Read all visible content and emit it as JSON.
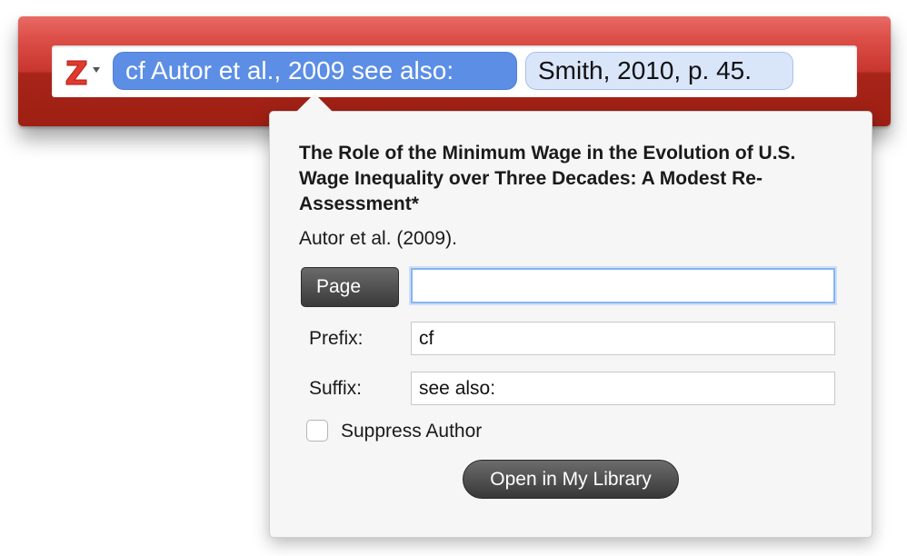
{
  "quick_format": {
    "logo_icon": "zotero-z-icon",
    "logo_dropdown_icon": "triangle-down-icon",
    "citations": [
      {
        "label": "cf Autor et al., 2009 see also:",
        "selected": true
      },
      {
        "label": "Smith, 2010, p. 45.",
        "selected": false
      }
    ]
  },
  "panel": {
    "title": "The Role of the Minimum Wage in the Evolution of U.S. Wage Inequality over Three Decades: A Modest Re-Assessment*",
    "citation": "Autor et al. (2009).",
    "locator_label": "Page",
    "locator_value": "",
    "prefix_label": "Prefix:",
    "prefix_value": "cf",
    "suffix_label": "Suffix:",
    "suffix_value": "see also:",
    "suppress_author_label": "Suppress Author",
    "suppress_author_checked": false,
    "open_library_label": "Open in My Library"
  },
  "colors": {
    "bar_red": "#c8362f",
    "selected_bubble": "#5c8ee6",
    "plain_bubble": "#d9e5f9",
    "focus_ring": "#86b4f4"
  }
}
